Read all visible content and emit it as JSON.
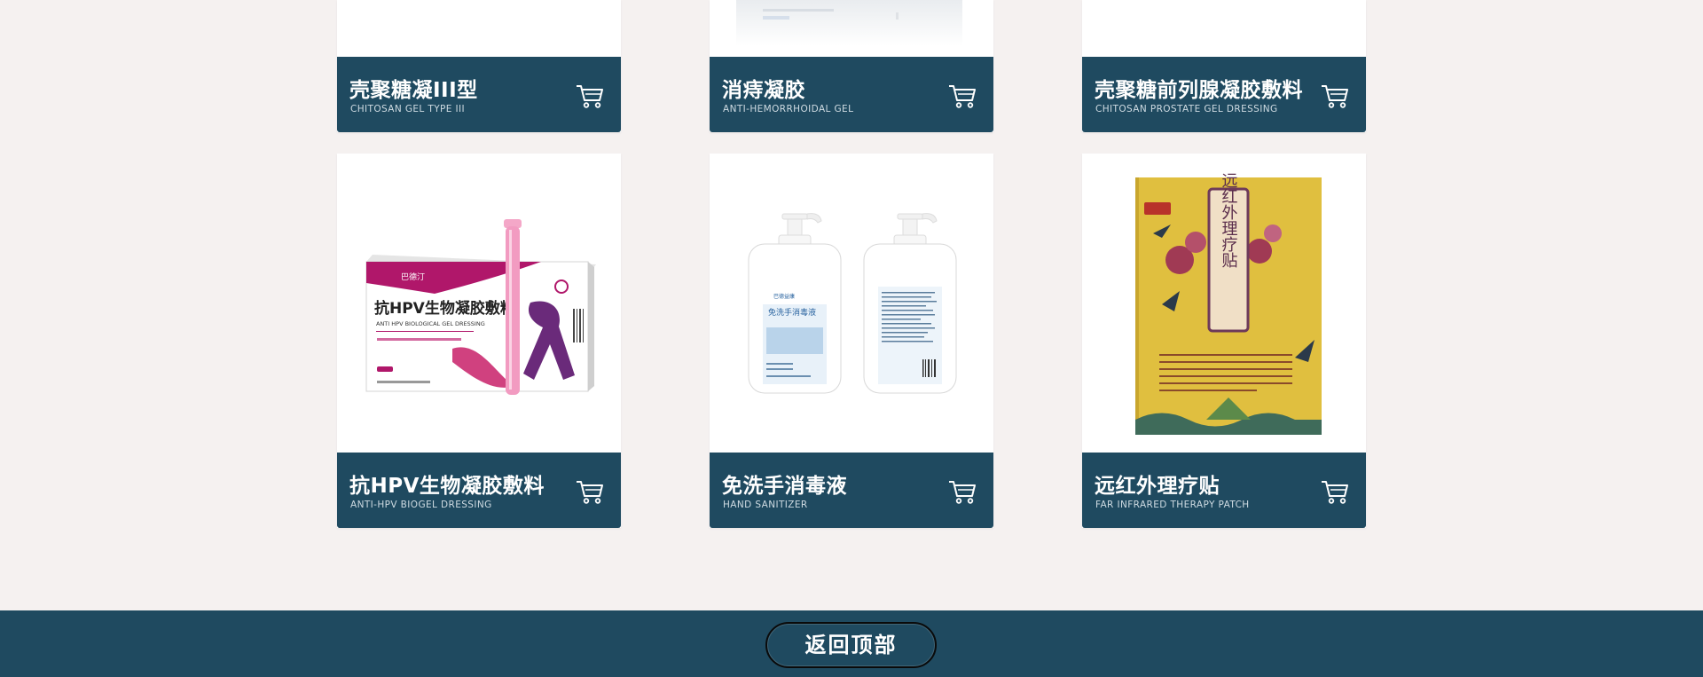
{
  "products": [
    {
      "name": "壳聚糖凝III型",
      "en": "CHITOSAN GEL TYPE III"
    },
    {
      "name": "消痔凝胶",
      "en": "ANTI-HEMORRHOIDAL GEL"
    },
    {
      "name": "壳聚糖前列腺凝胶敷料",
      "en": "CHITOSAN PROSTATE GEL DRESSING"
    },
    {
      "name": "抗HPV生物凝胶敷料",
      "en": "ANTI-HPV BIOGEL DRESSING"
    },
    {
      "name": "免洗手消毒液",
      "en": "HAND SANITIZER"
    },
    {
      "name": "远红外理疗贴",
      "en": "FAR INFRARED THERAPY PATCH"
    }
  ],
  "packaging": {
    "hpv_box_title": "抗HPV生物凝胶敷料",
    "hpv_box_subtitle": "ANTI HPV BIOLOGICAL GEL DRESSING",
    "sanitizer_label": "免洗手消毒液",
    "patch_title": "远红外理疗贴"
  },
  "icons": {
    "cart": "shopping-cart-icon"
  },
  "footer": {
    "back_to_top": "返回顶部"
  },
  "colors": {
    "brand_dark": "#1f4a60",
    "page_bg": "#f5f1f0"
  }
}
